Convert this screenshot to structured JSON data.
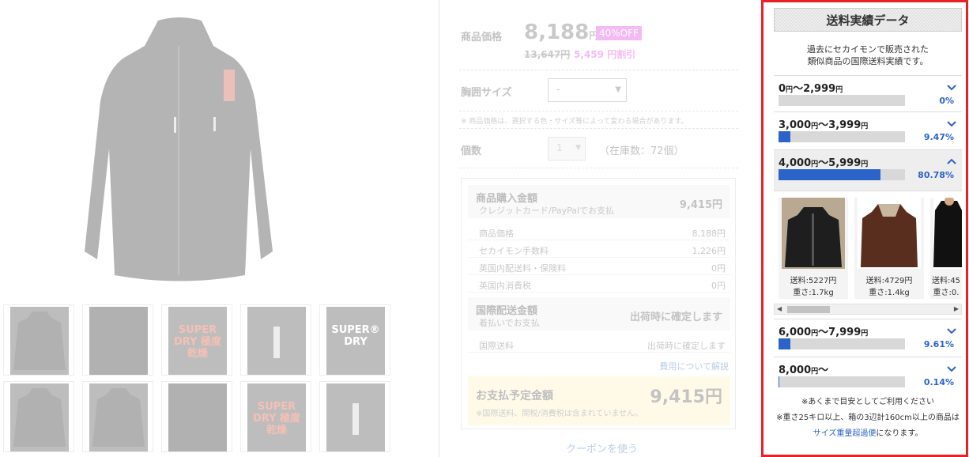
{
  "product": {
    "price_label": "商品価格",
    "price": "8,188",
    "price_unit": "円",
    "off_badge": "40%OFF",
    "old_price": "13,647円",
    "discount": "5,459 円割引",
    "size_label": "胸囲サイズ",
    "size_value": "-",
    "price_note": "※ 商品価格は、選択する色・サイズ等によって変わる場合があります。",
    "qty_label": "個数",
    "qty_value": "1",
    "stock": "（在庫数：72個）"
  },
  "purchase_box": {
    "head1_title": "商品購入金額",
    "head1_sub": "クレジットカード/PayPalでお支払",
    "head1_value": "9,415円",
    "rows1": [
      {
        "k": "商品価格",
        "v": "8,188円"
      },
      {
        "k": "セカイモン手数料",
        "v": "1,226円"
      },
      {
        "k": "英国内配送料・保険料",
        "v": "0円"
      },
      {
        "k": "英国内消費税",
        "v": "0円"
      }
    ],
    "head2_title": "国際配送金額",
    "head2_sub": "着払いでお支払",
    "head2_value": "出荷時に確定します",
    "rows2": [
      {
        "k": "国際送料",
        "v": "出荷時に確定します"
      }
    ],
    "cost_link": "費用について解説",
    "total_title": "お支払予定金額",
    "total_value": "9,415円",
    "total_note": "※国際送料、関税/消費税は含まれていません。"
  },
  "coupon_link": "クーポンを使う",
  "thumbnails": [
    {
      "kind": "jacket",
      "text": ""
    },
    {
      "kind": "detail",
      "text": ""
    },
    {
      "kind": "logo",
      "text": "SUPER DRY 極度乾燥"
    },
    {
      "kind": "zip",
      "text": ""
    },
    {
      "kind": "logo-white",
      "text": "SUPER® DRY"
    },
    {
      "kind": "jacket",
      "text": ""
    },
    {
      "kind": "jacket",
      "text": ""
    },
    {
      "kind": "detail",
      "text": ""
    },
    {
      "kind": "logo",
      "text": "SUPER DRY 極度乾燥"
    },
    {
      "kind": "zip",
      "text": ""
    }
  ],
  "shipping_panel": {
    "title": "送料実績データ",
    "intro_1": "過去にセカイモンで販売された",
    "intro_2": "類似商品の国際送料実績です。",
    "tiers": [
      {
        "from": "0",
        "from_unit": "円",
        "sep": "～",
        "to": "2,999",
        "to_unit": "円",
        "percent": "0%",
        "fraction": 0.0,
        "expanded": false
      },
      {
        "from": "3,000",
        "from_unit": "円",
        "sep": "～",
        "to": "3,999",
        "to_unit": "円",
        "percent": "9.47%",
        "fraction": 0.0947,
        "expanded": false
      },
      {
        "from": "4,000",
        "from_unit": "円",
        "sep": "～",
        "to": "5,999",
        "to_unit": "円",
        "percent": "80.78%",
        "fraction": 0.8078,
        "expanded": true
      },
      {
        "from": "6,000",
        "from_unit": "円",
        "sep": "～",
        "to": "7,999",
        "to_unit": "円",
        "percent": "9.61%",
        "fraction": 0.0961,
        "expanded": false
      },
      {
        "from": "8,000",
        "from_unit": "円",
        "sep": "～",
        "to": "",
        "to_unit": "",
        "percent": "0.14%",
        "fraction": 0.0014,
        "expanded": false
      }
    ],
    "examples": [
      {
        "shipping": "送料:5227円",
        "weight": "重さ:1.7kg"
      },
      {
        "shipping": "送料:4729円",
        "weight": "重さ:1.4kg"
      },
      {
        "shipping": "送料:45",
        "weight": "重さ:0."
      }
    ],
    "note_1": "※あくまで目安としてご利用ください",
    "note_2_a": "※重さ25キロ以上、箱の3辺計160cm以上の商品は",
    "note_2_link": "サイズ重量超過便",
    "note_2_b": "になります。",
    "colors": {
      "accent": "#2c63c9",
      "frame": "#e8202a"
    }
  }
}
